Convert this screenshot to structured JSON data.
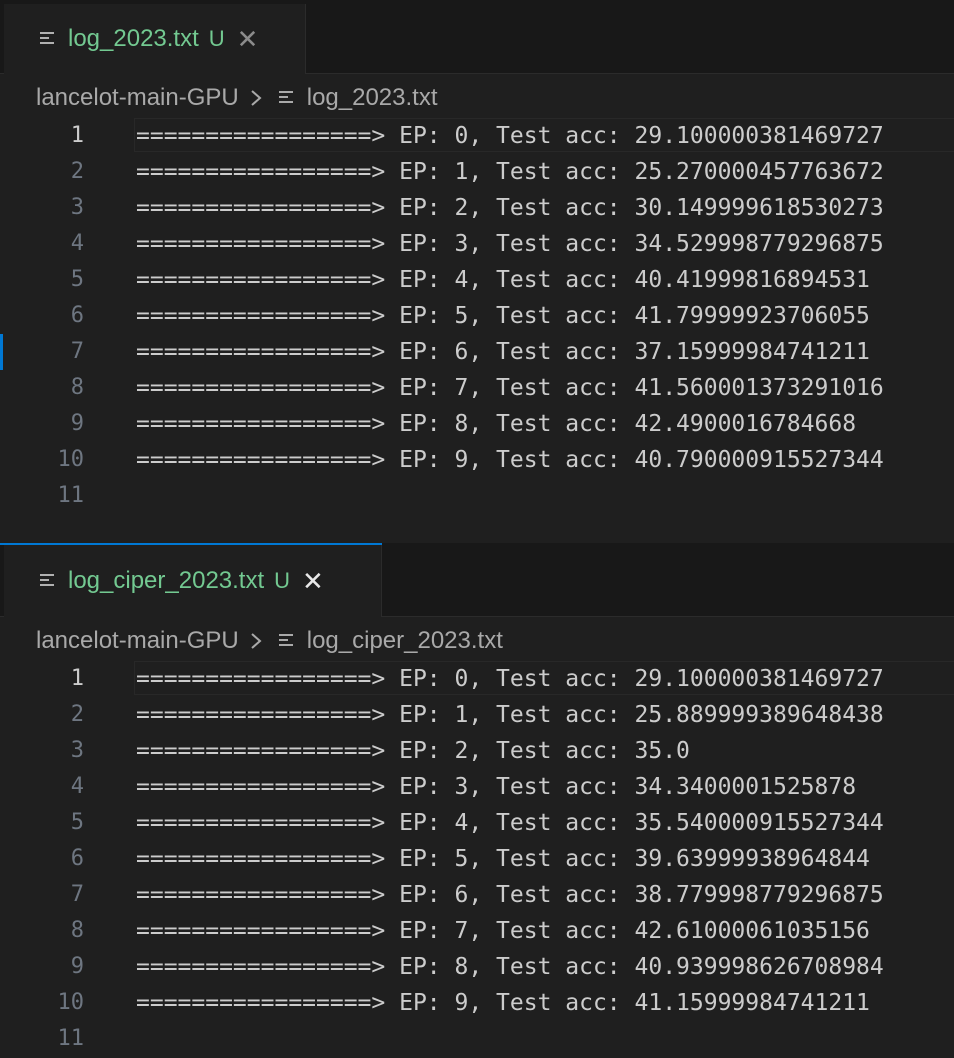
{
  "panes": [
    {
      "tab": {
        "file": "log_2023.txt",
        "status": "U"
      },
      "breadcrumb": {
        "folder": "lancelot-main-GPU",
        "file": "log_2023.txt"
      },
      "lines": [
        {
          "n": "1",
          "text": "=================> EP: 0, Test acc: 29.100000381469727"
        },
        {
          "n": "2",
          "text": "=================> EP: 1, Test acc: 25.270000457763672"
        },
        {
          "n": "3",
          "text": "=================> EP: 2, Test acc: 30.149999618530273"
        },
        {
          "n": "4",
          "text": "=================> EP: 3, Test acc: 34.529998779296875"
        },
        {
          "n": "5",
          "text": "=================> EP: 4, Test acc: 40.41999816894531"
        },
        {
          "n": "6",
          "text": "=================> EP: 5, Test acc: 41.79999923706055"
        },
        {
          "n": "7",
          "text": "=================> EP: 6, Test acc: 37.15999984741211"
        },
        {
          "n": "8",
          "text": "=================> EP: 7, Test acc: 41.560001373291016"
        },
        {
          "n": "9",
          "text": "=================> EP: 8, Test acc: 42.4900016784668"
        },
        {
          "n": "10",
          "text": "=================> EP: 9, Test acc: 40.790000915527344"
        },
        {
          "n": "11",
          "text": ""
        }
      ]
    },
    {
      "tab": {
        "file": "log_ciper_2023.txt",
        "status": "U"
      },
      "breadcrumb": {
        "folder": "lancelot-main-GPU",
        "file": "log_ciper_2023.txt"
      },
      "lines": [
        {
          "n": "1",
          "text": "=================> EP: 0, Test acc: 29.100000381469727"
        },
        {
          "n": "2",
          "text": "=================> EP: 1, Test acc: 25.889999389648438"
        },
        {
          "n": "3",
          "text": "=================> EP: 2, Test acc: 35.0"
        },
        {
          "n": "4",
          "text": "=================> EP: 3, Test acc: 34.3400001525878"
        },
        {
          "n": "5",
          "text": "=================> EP: 4, Test acc: 35.540000915527344"
        },
        {
          "n": "6",
          "text": "=================> EP: 5, Test acc: 39.63999938964844"
        },
        {
          "n": "7",
          "text": "=================> EP: 6, Test acc: 38.779998779296875"
        },
        {
          "n": "8",
          "text": "=================> EP: 7, Test acc: 42.61000061035156"
        },
        {
          "n": "9",
          "text": "=================> EP: 8, Test acc: 40.939998626708984"
        },
        {
          "n": "10",
          "text": "=================> EP: 9, Test acc: 41.15999984741211"
        },
        {
          "n": "11",
          "text": ""
        }
      ]
    }
  ],
  "colors": {
    "editor_bg": "#1f1f1f",
    "tabbar_bg": "#181818",
    "untracked_green": "#73c991",
    "text": "#cccccc",
    "line_number": "#6e7681",
    "accent": "#0078d4"
  }
}
